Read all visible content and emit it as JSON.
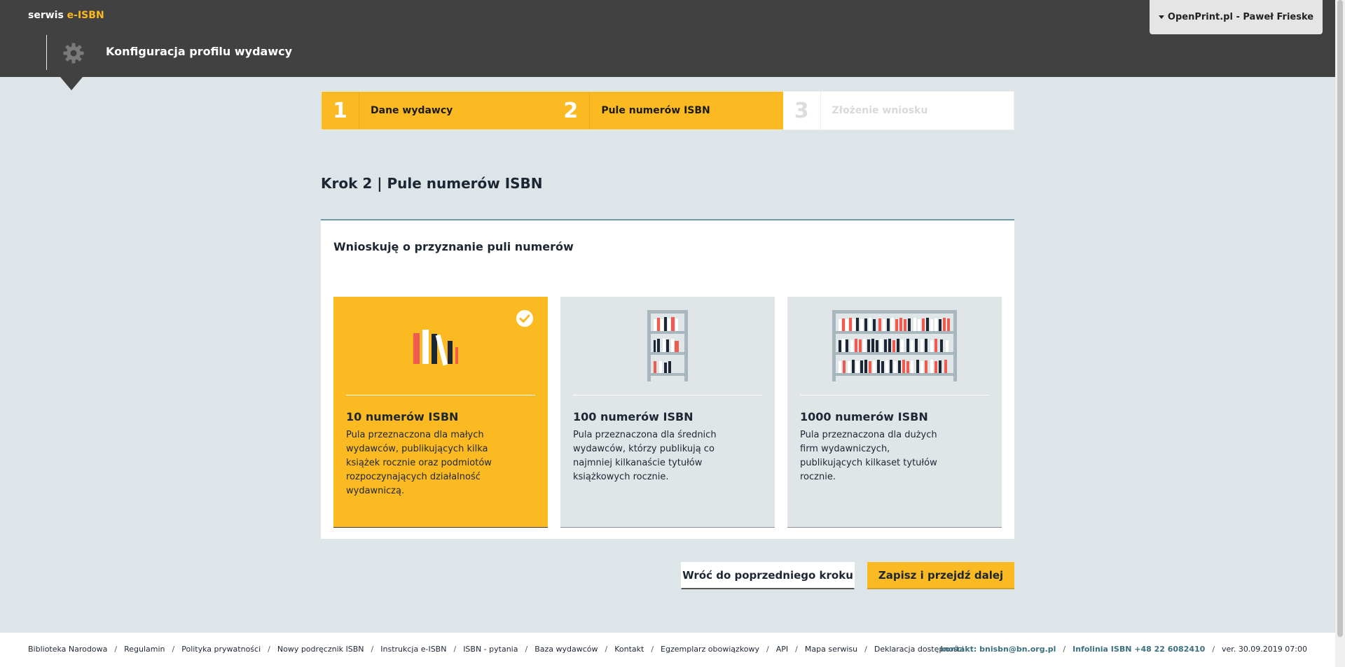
{
  "header": {
    "brand_prefix": "serwis ",
    "brand_accent": "e-ISBN",
    "page_title": "Konfiguracja profilu wydawcy",
    "user_menu": "OpenPrint.pl - Paweł Frieske",
    "gear_icon": "gear-icon"
  },
  "steps": [
    {
      "number": "1",
      "label": "Dane wydawcy",
      "state": "done"
    },
    {
      "number": "2",
      "label": "Pule numerów ISBN",
      "state": "active"
    },
    {
      "number": "3",
      "label": "Złożenie wniosku",
      "state": "inactive"
    }
  ],
  "main": {
    "heading": "Krok 2 | Pule numerów ISBN",
    "panel_title": "Wnioskuję o przyznanie puli numerów",
    "options": [
      {
        "title": "10 numerów ISBN",
        "description": "Pula przeznaczona dla małych wydawców, publikujących kilka książek rocznie oraz podmiotów rozpoczynających działalność wydawniczą.",
        "selected": true,
        "icon": "books-row-icon"
      },
      {
        "title": "100 numerów ISBN",
        "description": "Pula przeznaczona dla średnich wydawców, którzy publikują co najmniej kilkanaście tytułów książkowych rocznie.",
        "selected": false,
        "icon": "small-bookshelf-icon"
      },
      {
        "title": "1000 numerów ISBN",
        "description": "Pula przeznaczona dla dużych firm wydawniczych, publikujących kilkaset tytułów rocznie.",
        "selected": false,
        "icon": "large-bookshelf-icon"
      }
    ],
    "back_button": "Wróć do poprzedniego kroku",
    "next_button": "Zapisz i przejdź dalej"
  },
  "footer": {
    "links": [
      "Biblioteka Narodowa",
      "Regulamin",
      "Polityka prywatności",
      "Nowy podręcznik ISBN",
      "Instrukcja e-ISBN",
      "ISBN - pytania",
      "Baza wydawców",
      "Kontakt",
      "Egzemplarz obowiązkowy",
      "API",
      "Mapa serwisu",
      "Deklaracja dostępności"
    ],
    "contact": "kontakt: bnisbn@bn.org.pl",
    "infolinia": "Infolinia ISBN +48 22 6082410",
    "version": "ver. 30.09.2019 07:00"
  },
  "colors": {
    "accent": "#fbba21",
    "header_bg": "#414141",
    "page_bg": "#dde5e8",
    "book_red": "#f05a4f",
    "book_dark": "#1d2733"
  }
}
